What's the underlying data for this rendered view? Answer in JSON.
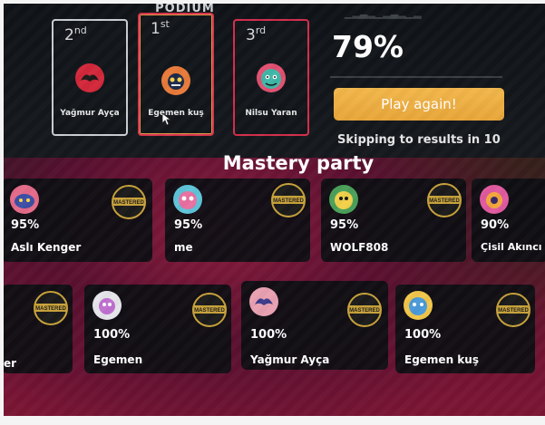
{
  "podium": {
    "title": "PODIUM",
    "entries": [
      {
        "rank_num": "2",
        "rank_suffix": "nd",
        "name": "Yağmur Ayça",
        "border": "#c9ccd0"
      },
      {
        "rank_num": "1",
        "rank_suffix": "st",
        "name": "Egemen kuş",
        "border": "#d7344a"
      },
      {
        "rank_num": "3",
        "rank_suffix": "rd",
        "name": "Nilsu Yaran",
        "border": "#d42d4a"
      }
    ]
  },
  "result": {
    "percent": "79%",
    "play_again_label": "Play again!",
    "skipping_text": "Skipping to results in 10"
  },
  "mastery": {
    "title": "Mastery party",
    "badge_text": "MASTERED",
    "row1": [
      {
        "percent": "95%",
        "name": "Aslı Kenger"
      },
      {
        "percent": "95%",
        "name": "me"
      },
      {
        "percent": "95%",
        "name": "WOLF808"
      },
      {
        "percent": "90%",
        "name": "Çisil Akıncı"
      }
    ],
    "row2": [
      {
        "percent": "",
        "name": "er"
      },
      {
        "percent": "100%",
        "name": "Egemen"
      },
      {
        "percent": "100%",
        "name": "Yağmur Ayça"
      },
      {
        "percent": "100%",
        "name": "Egemen kuş"
      }
    ]
  },
  "colors": {
    "accent_orange": "#e8a63a",
    "gold_badge": "#c8a23a",
    "card_bg": "#0c0e12"
  }
}
